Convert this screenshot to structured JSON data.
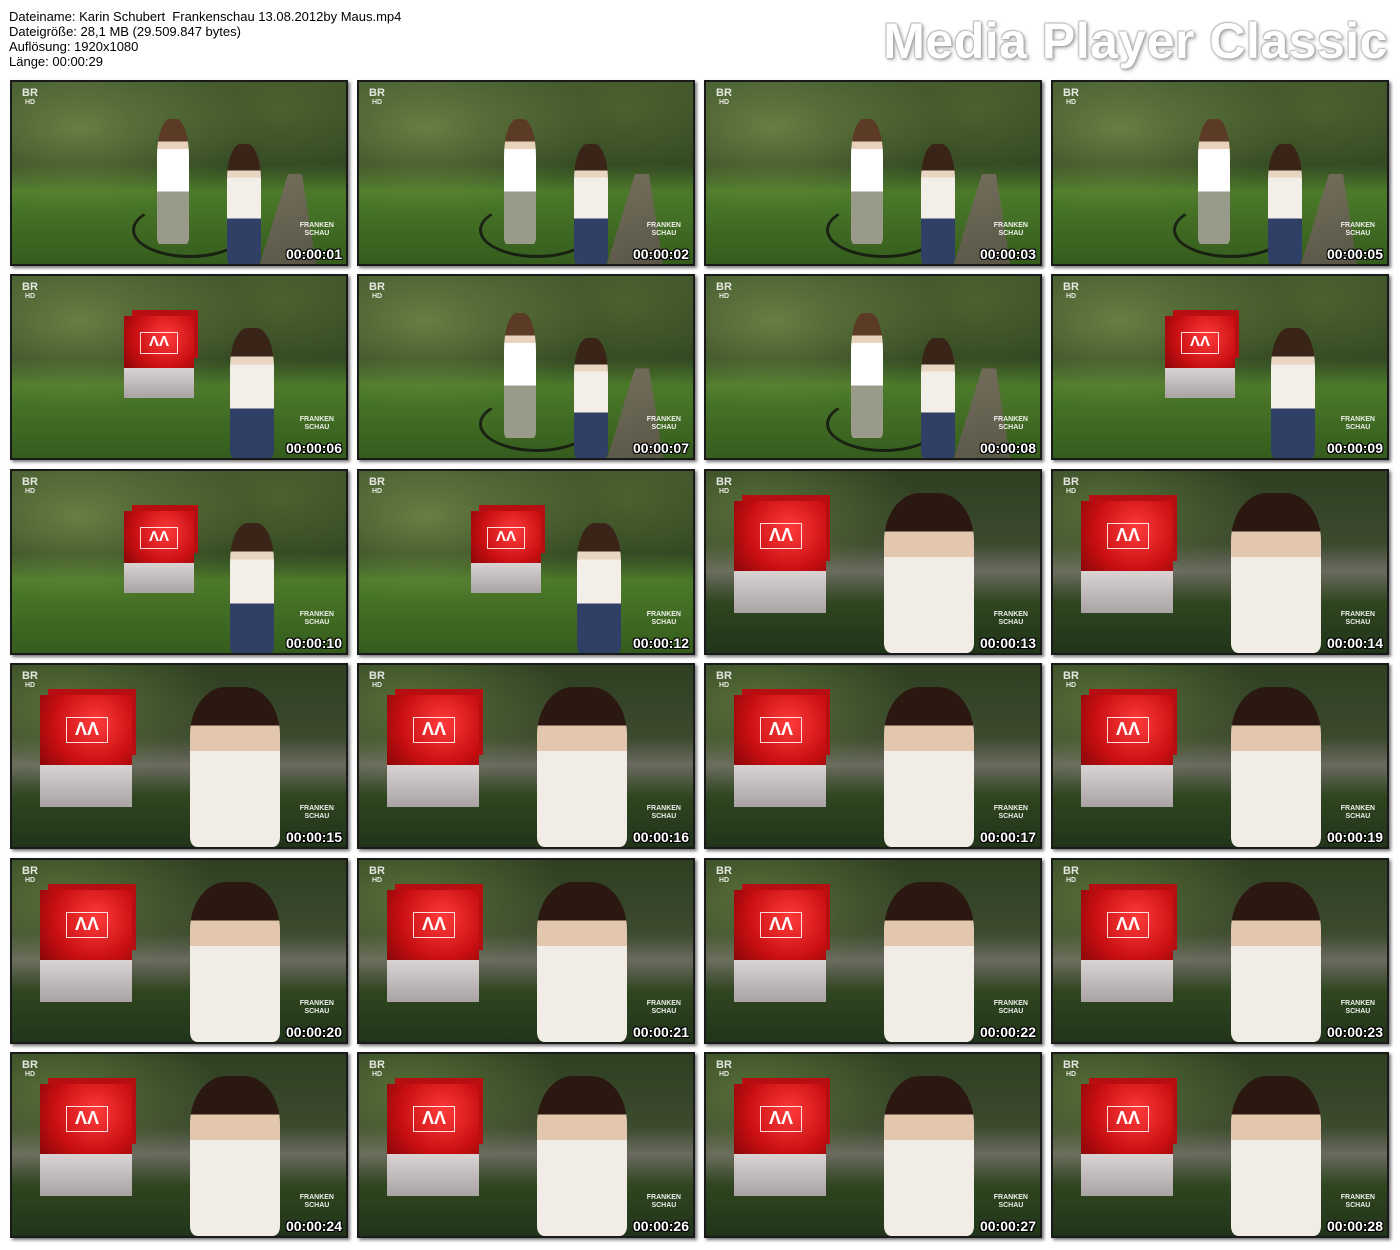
{
  "file_info": {
    "filename_line": "Dateiname: Karin Schubert  Frankenschau 13.08.2012by Maus.mp4",
    "size_line": "Dateigröße: 28,1 MB (29.509.847 bytes)",
    "resolution_line": "Auflösung: 1920x1080",
    "length_line": "Länge: 00:00:29"
  },
  "brand": {
    "title": "Media Player Classic"
  },
  "overlay": {
    "channel": "BR",
    "channel_sub": "HD",
    "show_line1": "FRANKEN",
    "show_line2": "SCHAU",
    "panel_logo": "ΛΛ"
  },
  "thumbnails": [
    {
      "timestamp": "00:00:01",
      "shot": "wide"
    },
    {
      "timestamp": "00:00:02",
      "shot": "wide"
    },
    {
      "timestamp": "00:00:03",
      "shot": "wide"
    },
    {
      "timestamp": "00:00:05",
      "shot": "wide"
    },
    {
      "timestamp": "00:00:06",
      "shot": "mid"
    },
    {
      "timestamp": "00:00:07",
      "shot": "wide"
    },
    {
      "timestamp": "00:00:08",
      "shot": "wide"
    },
    {
      "timestamp": "00:00:09",
      "shot": "mid"
    },
    {
      "timestamp": "00:00:10",
      "shot": "mid"
    },
    {
      "timestamp": "00:00:12",
      "shot": "mid"
    },
    {
      "timestamp": "00:00:13",
      "shot": "close"
    },
    {
      "timestamp": "00:00:14",
      "shot": "close"
    },
    {
      "timestamp": "00:00:15",
      "shot": "close"
    },
    {
      "timestamp": "00:00:16",
      "shot": "close"
    },
    {
      "timestamp": "00:00:17",
      "shot": "close"
    },
    {
      "timestamp": "00:00:19",
      "shot": "close"
    },
    {
      "timestamp": "00:00:20",
      "shot": "close"
    },
    {
      "timestamp": "00:00:21",
      "shot": "close"
    },
    {
      "timestamp": "00:00:22",
      "shot": "close"
    },
    {
      "timestamp": "00:00:23",
      "shot": "close"
    },
    {
      "timestamp": "00:00:24",
      "shot": "close"
    },
    {
      "timestamp": "00:00:26",
      "shot": "close"
    },
    {
      "timestamp": "00:00:27",
      "shot": "close"
    },
    {
      "timestamp": "00:00:28",
      "shot": "close"
    }
  ]
}
